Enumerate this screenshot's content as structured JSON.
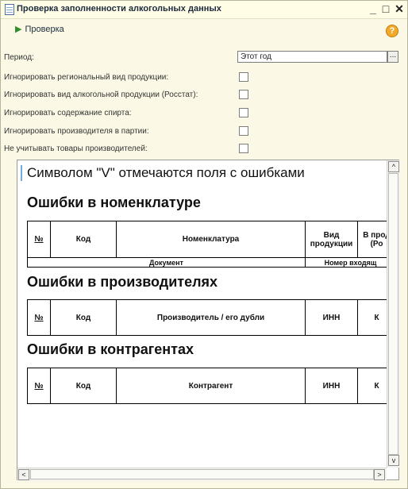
{
  "window": {
    "title": "Проверка заполненности алкогольных данных",
    "minimize_glyph": "_",
    "maximize_glyph": "□",
    "close_glyph": "✕"
  },
  "toolbar": {
    "run_label": "Проверка",
    "run_icon": "play-icon",
    "help_glyph": "?"
  },
  "form": {
    "period_label": "Период:",
    "period_value": "Этот год",
    "period_button": "...",
    "options": [
      {
        "label": "Игнорировать региональный вид продукции:",
        "checked": false
      },
      {
        "label": "Игнорировать вид алкогольной продукции (Росстат):",
        "checked": false
      },
      {
        "label": "Игнорировать содержание спирта:",
        "checked": false
      },
      {
        "label": "Игнорировать производителя в партии:",
        "checked": false
      },
      {
        "label": "Не учитывать товары производителей:",
        "checked": false
      }
    ]
  },
  "report": {
    "hint": "Символом \"V\" отмечаются поля с ошибками",
    "nomenclature": {
      "heading": "Ошибки в номенклатуре",
      "columns": [
        "№",
        "Код",
        "Номенклатура",
        "Вид продукции",
        "В прод (Ро"
      ],
      "subrow": [
        "Документ",
        "Номер входящ"
      ]
    },
    "manufacturers": {
      "heading": "Ошибки в производителях",
      "columns": [
        "№",
        "Код",
        "Производитель / его дубли",
        "ИНН",
        "К"
      ]
    },
    "counterparties": {
      "heading": "Ошибки в контрагентах",
      "columns": [
        "№",
        "Код",
        "Контрагент",
        "ИНН",
        "К"
      ]
    }
  },
  "scrollbars": {
    "up": "^",
    "down": "v",
    "left": "<",
    "right": ">"
  }
}
